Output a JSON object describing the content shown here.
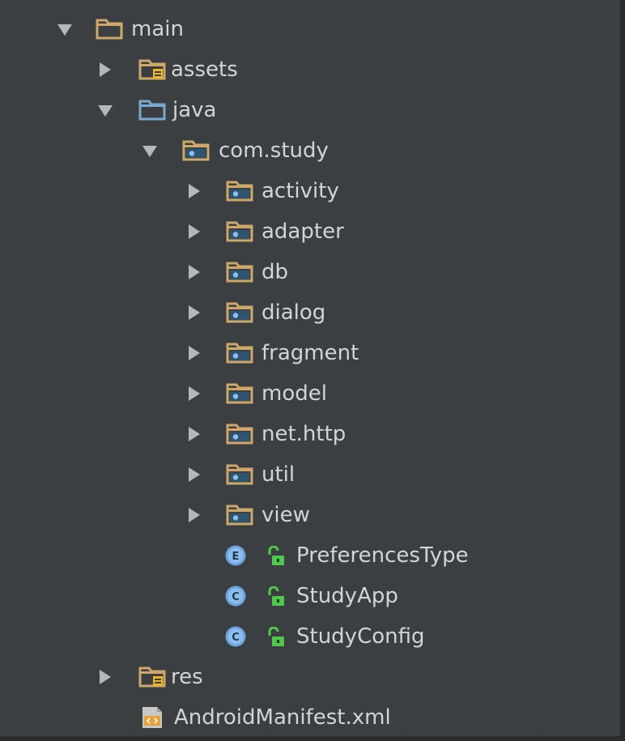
{
  "tree": {
    "main": {
      "label": "main"
    },
    "assets": {
      "label": "assets"
    },
    "java": {
      "label": "java"
    },
    "com_study": {
      "label": "com.study"
    },
    "packages": [
      {
        "label": "activity"
      },
      {
        "label": "adapter"
      },
      {
        "label": "db"
      },
      {
        "label": "dialog"
      },
      {
        "label": "fragment"
      },
      {
        "label": "model"
      },
      {
        "label": "net.http"
      },
      {
        "label": "util"
      },
      {
        "label": "view"
      }
    ],
    "classes": [
      {
        "label": "PreferencesType",
        "badge": "E"
      },
      {
        "label": "StudyApp",
        "badge": "C"
      },
      {
        "label": "StudyConfig",
        "badge": "C"
      }
    ],
    "res": {
      "label": "res"
    },
    "manifest": {
      "label": "AndroidManifest.xml"
    }
  },
  "colors": {
    "background": "#3c3f41",
    "text": "#d2d4d6",
    "folder": "#cda86a",
    "java_folder": "#79a8d0",
    "package_dot": "#5b8bb5",
    "resource_badge": "#f0b428",
    "class_badge": "#6aa5e0",
    "lock": "#4ec949"
  },
  "icons": {
    "expanded": "triangle-down-icon",
    "collapsed": "triangle-right-icon",
    "folder": "folder-icon",
    "source_root": "source-folder-icon",
    "package": "package-folder-icon",
    "resource_folder": "resource-folder-icon",
    "enum": "enum-icon",
    "class": "class-icon",
    "public": "lock-open-icon",
    "manifest": "xml-file-icon"
  }
}
